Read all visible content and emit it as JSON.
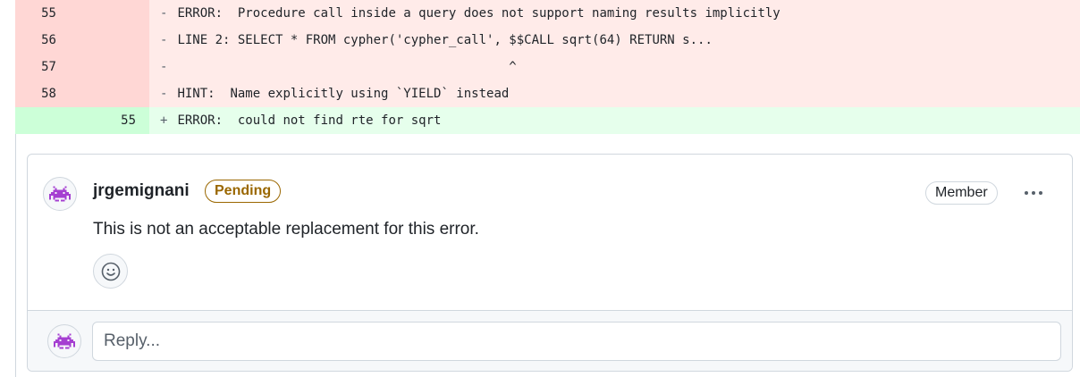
{
  "diff": {
    "rows": [
      {
        "type": "del",
        "old": "55",
        "new": "",
        "sign": "-",
        "text": "ERROR:  Procedure call inside a query does not support naming results implicitly"
      },
      {
        "type": "del",
        "old": "56",
        "new": "",
        "sign": "-",
        "text": "LINE 2: SELECT * FROM cypher('cypher_call', $$CALL sqrt(64) RETURN s..."
      },
      {
        "type": "del",
        "old": "57",
        "new": "",
        "sign": "-",
        "text": "                                            ^"
      },
      {
        "type": "del",
        "old": "58",
        "new": "",
        "sign": "-",
        "text": "HINT:  Name explicitly using `YIELD` instead"
      },
      {
        "type": "add",
        "old": "",
        "new": "55",
        "sign": "+",
        "text": "ERROR:  could not find rte for sqrt"
      }
    ]
  },
  "comment": {
    "author": "jrgemignani",
    "status_badge": "Pending",
    "role_badge": "Member",
    "body": "This is not an acceptable replacement for this error.",
    "avatar_icon": "space-invader-icon",
    "reaction_icon": "smiley-icon",
    "menu_icon": "kebab-horizontal-icon"
  },
  "reply": {
    "placeholder": "Reply..."
  },
  "colors": {
    "deletion_bg": "#ffebe9",
    "deletion_gutter": "#ffd7d5",
    "addition_bg": "#e6ffec",
    "addition_gutter": "#ccffd8",
    "pending": "#9a6700",
    "avatar": "#a53fd1"
  }
}
